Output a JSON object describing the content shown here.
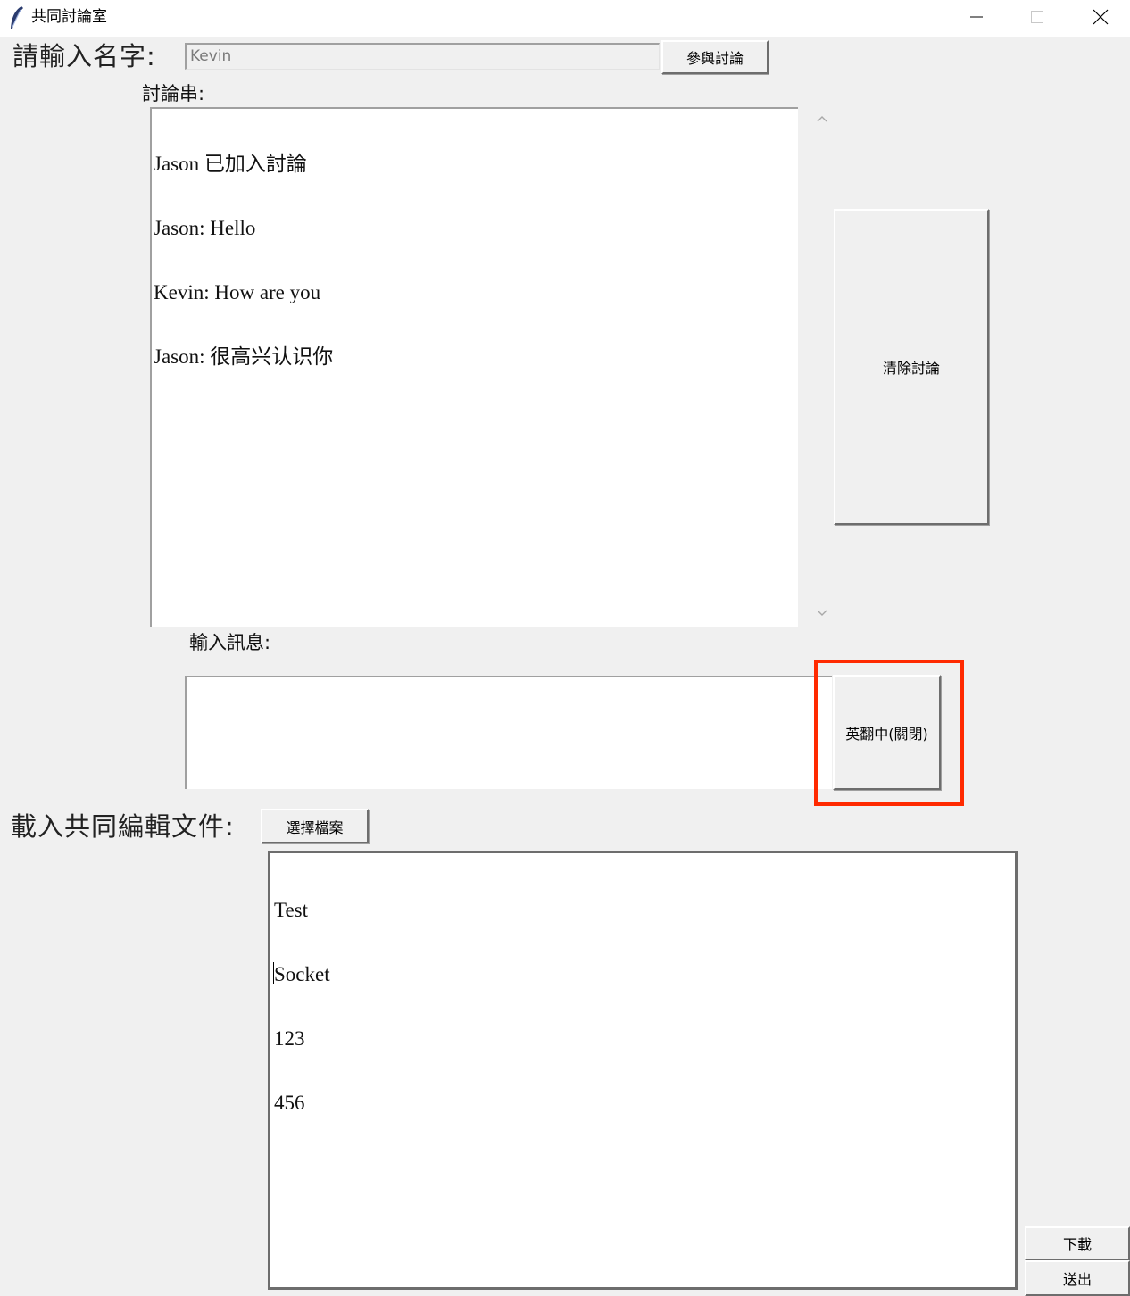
{
  "window": {
    "title": "共同討論室"
  },
  "name_row": {
    "label": "請輸入名字:",
    "name_value": "Kevin",
    "join_button": "參與討論"
  },
  "chat": {
    "label": "討論串:",
    "lines": [
      "Jason 已加入討論",
      "Jason: Hello",
      "Kevin: How are you",
      "Jason: 很高兴认识你"
    ],
    "clear_button": "清除討論"
  },
  "message": {
    "label": "輸入訊息:",
    "value": "",
    "translate_button": "英翻中(關閉)"
  },
  "document": {
    "label": "載入共同編輯文件:",
    "choose_button": "選擇檔案",
    "lines": [
      "Test",
      "Socket",
      "123",
      "456",
      ""
    ],
    "download_button": "下載",
    "send_button": "送出"
  },
  "icons": {
    "app": "feather-icon",
    "minimize": "minimize-icon",
    "maximize": "maximize-icon",
    "close": "close-icon",
    "scroll_up": "chevron-up-icon",
    "scroll_down": "chevron-down-icon"
  },
  "colors": {
    "window_bg": "#f0f0f0",
    "highlight": "#ff2a00"
  }
}
